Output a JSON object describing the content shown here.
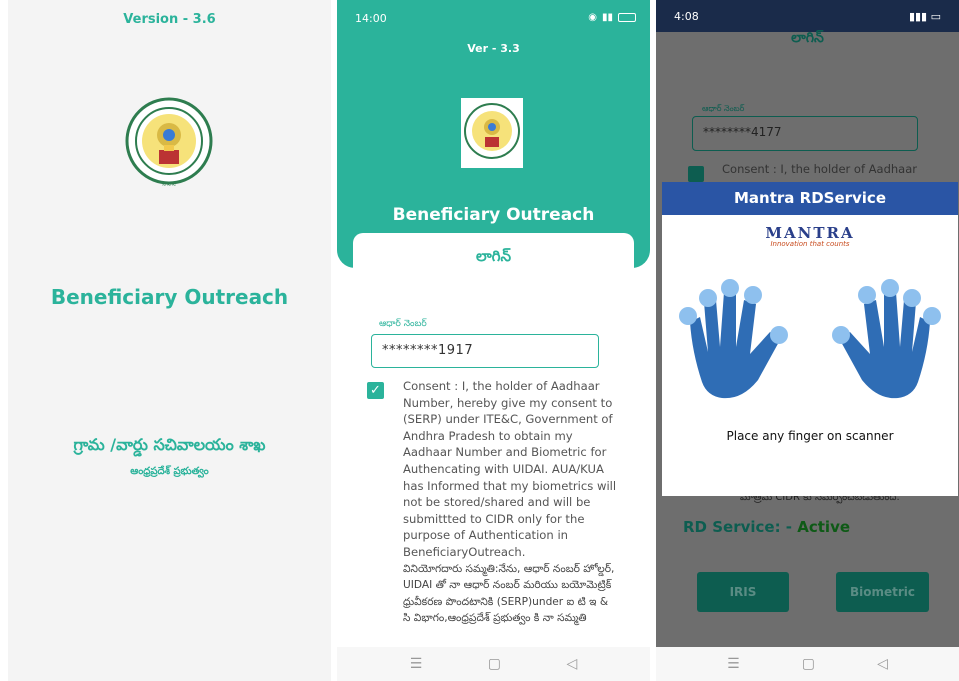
{
  "splash": {
    "version": "Version - 3.6",
    "app_name": "Beneficiary Outreach",
    "department_telugu": "గ్రామ /వార్డు సచివాలయం శాఖ",
    "government_telugu": "ఆంధ్రప్రదేశ్ ప్రభుత్వం"
  },
  "login": {
    "status_time": "14:00",
    "version": "Ver - 3.3",
    "app_name": "Beneficiary Outreach",
    "title": "లాగిన్",
    "aadhaar_label": "ఆధార్ నెంబర్",
    "aadhaar_value": "********1917",
    "consent_checked": true,
    "consent_en": "Consent : I, the holder of Aadhaar Number, hereby give my consent to (SERP) under ITE&C, Government of Andhra Pradesh to obtain my Aadhaar Number and Biometric for Authencating with UIDAI. AUA/KUA has Informed that my biometrics will not be stored/shared and will be submittted to CIDR only for the purpose of Authentication in BeneficiaryOutreach.",
    "consent_te": "వినియోగదారు సమ్మతి:నేను, ఆధార్ నంబర్ హోల్డర్, UIDAI తో నా ఆధార్ నంబర్ మరియు బయోమెట్రిక్ ధ్రువీకరణ పొందటానికి (SERP)under ఐ టి ఇ & సి విభాగం,ఆంధ్రప్రదేశ్ ప్రభుత్వం కి నా సమ్మతి"
  },
  "rdservice": {
    "status_time": "4:08",
    "login_title": "లాగిన్",
    "aadhaar_label": "ఆధార్ నెంబర్",
    "aadhaar_value": "********4177",
    "consent_snippet": "Consent : I, the holder of Aadhaar",
    "cidr_snippet": "మాత్రమే CIDR కు సమర్పించబడుతుంది.",
    "rd_label": "RD Service: -",
    "rd_status": "Active",
    "iris_button": "IRIS",
    "biometric_button": "Biometric",
    "dialog_title": "Mantra RDService",
    "brand": "MANTRA",
    "brand_tagline": "Innovation that counts",
    "instruction": "Place any finger on scanner"
  },
  "colors": {
    "accent": "#2bb39b",
    "dialog_header": "#2a55a5",
    "hand": "#2f6db5"
  }
}
